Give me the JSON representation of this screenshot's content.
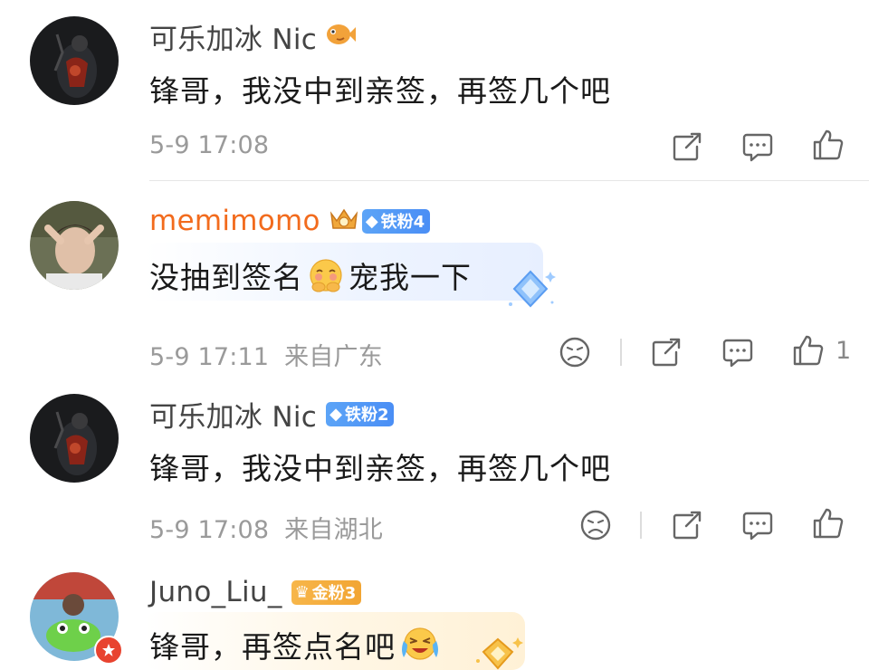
{
  "comments": [
    {
      "username": "可乐加冰 Nic",
      "text": "锋哥，我没中到亲签，再签几个吧",
      "time": "5-9 17:08",
      "location": ""
    },
    {
      "username": "memimomo",
      "badge": "铁粉4",
      "text_part1": "没抽到签名",
      "text_part2": "宠我一下",
      "time": "5-9 17:11",
      "location": "来自广东",
      "like_count": "1"
    },
    {
      "username": "可乐加冰 Nic",
      "badge": "铁粉2",
      "text": "锋哥，我没中到亲签，再签几个吧",
      "time": "5-9 17:08",
      "location": "来自湖北"
    },
    {
      "username": "Juno_Liu_",
      "badge": "金粉3",
      "text": "锋哥，再签点名吧"
    }
  ],
  "icons": {
    "share": "share-icon",
    "comment": "comment-icon",
    "like": "thumbs-up-icon",
    "dislike": "sad-face-icon"
  },
  "colors": {
    "vip_name": "#f26b1d",
    "badge_blue": "#4a8ef5",
    "badge_gold": "#f2a533",
    "meta_text": "#9a9a9a"
  }
}
